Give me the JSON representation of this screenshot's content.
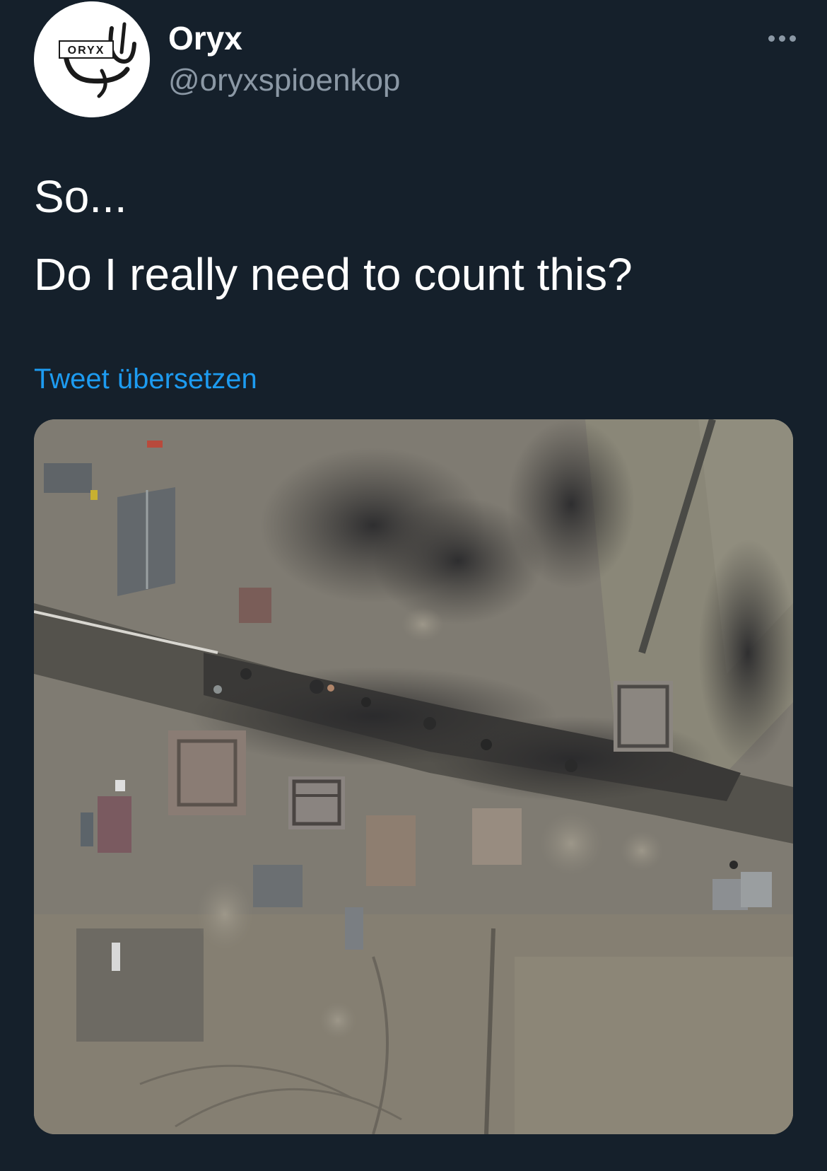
{
  "author": {
    "name": "Oryx",
    "handle": "@oryxspioenkop",
    "avatar_logo_text": "ORYX"
  },
  "tweet": {
    "lines": [
      "So...",
      "Do I really need to count this?"
    ],
    "translate_label": "Tweet übersetzen"
  },
  "icons": {
    "more": "more-options-icon"
  },
  "colors": {
    "background": "#15202b",
    "text_primary": "#ffffff",
    "text_secondary": "#8b98a5",
    "link": "#1d9bf0"
  },
  "media": {
    "type": "satellite-image"
  }
}
